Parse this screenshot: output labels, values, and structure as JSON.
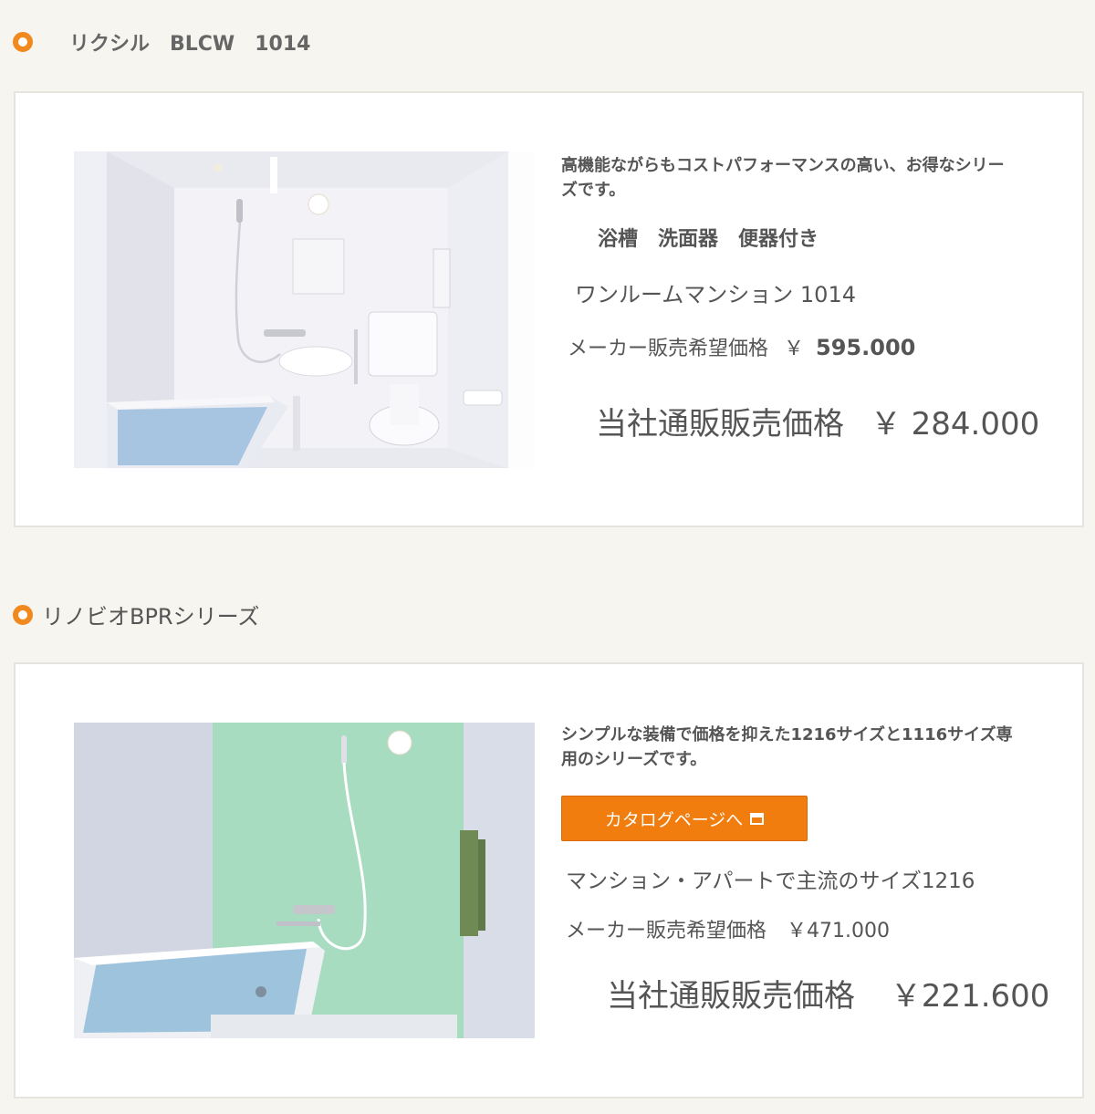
{
  "section1": {
    "title": "リクシル　BLCW　1014",
    "description": "高機能ながらもコストパフォーマンスの高い、お得なシリーズです。",
    "features": "浴槽　洗面器　便器付き",
    "model": "ワンルームマンション 1014",
    "list_price_label": "メーカー販売希望価格",
    "list_price_yen": "￥",
    "list_price_value": "595.000",
    "our_price_label": "当社通販販売価格",
    "our_price_value": "￥ 284.000"
  },
  "section2": {
    "title": "リノビオBPRシリーズ",
    "description": "シンプルな装備で価格を抑えた1216サイズと1116サイズ専用のシリーズです。",
    "catalog_button": "カタログページへ",
    "model": "マンション・アパートで主流のサイズ1216",
    "list_price": "メーカー販売希望価格　￥471.000",
    "our_price_label": "当社通販販売価格",
    "our_price_value": "￥221.600"
  },
  "colors": {
    "accent": "#f08a1e",
    "button": "#f07d0e",
    "wall_green": "#a8dcc0",
    "water": "#9ec3dd"
  },
  "icons": [
    "circle-bullet-icon",
    "external-window-icon"
  ]
}
